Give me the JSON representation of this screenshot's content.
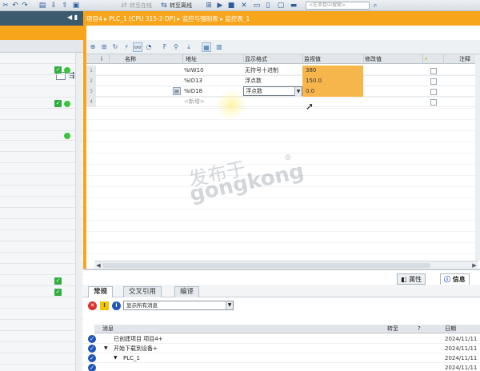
{
  "toolbar": {
    "go_online": "转至在线",
    "go_offline": "转至离线",
    "search_placeholder": "<在项目中搜索>"
  },
  "breadcrumb": {
    "sep": "▸",
    "items": [
      "项目4",
      "PLC_1 [CPU 315-2 DP]",
      "监控与强制表",
      "监控表_1"
    ]
  },
  "watch_table": {
    "headers": {
      "index": "i",
      "name": "名称",
      "address": "地址",
      "display_format": "显示格式",
      "monitor_value": "监视值",
      "modify_value": "修改值",
      "comment": "注释"
    },
    "rows": [
      {
        "n": "1",
        "name": "",
        "address": "%IW10",
        "format": "无符号十进制",
        "value": "380"
      },
      {
        "n": "2",
        "name": "",
        "address": "%ID13",
        "format": "浮点数",
        "value": "150.0"
      },
      {
        "n": "3",
        "name": "",
        "address": "%ID18",
        "format": "浮点数",
        "value": "0.0"
      },
      {
        "n": "4",
        "name": "",
        "address": "<新增>",
        "format": "",
        "value": ""
      }
    ]
  },
  "inspector": {
    "tab_properties": "属性",
    "tab_info": "信息",
    "subtabs": [
      "常规",
      "交叉引用",
      "编译"
    ],
    "filter": "显示所有消息",
    "msg_headers": {
      "message": "消息",
      "goto": "转至",
      "q": "?",
      "date": "日期"
    },
    "messages": [
      {
        "indent": 14,
        "expand": "",
        "text": "已创建项目 项目4+",
        "date": "2024/11/11"
      },
      {
        "indent": 14,
        "expand": "▼",
        "text": "开始下载到设备+",
        "date": "2024/11/11"
      },
      {
        "indent": 24,
        "expand": "▼",
        "text": "PLC_1",
        "date": "2024/11/11"
      },
      {
        "indent": 34,
        "expand": "",
        "text": "",
        "date": "2024/11/11"
      }
    ]
  },
  "watermark": {
    "line1": "发布于",
    "line2": "gongkong",
    "mark": "®"
  },
  "colors": {
    "accent_orange": "#f7a51a",
    "status_green": "#2fae3e",
    "info_blue": "#1e56b8"
  }
}
